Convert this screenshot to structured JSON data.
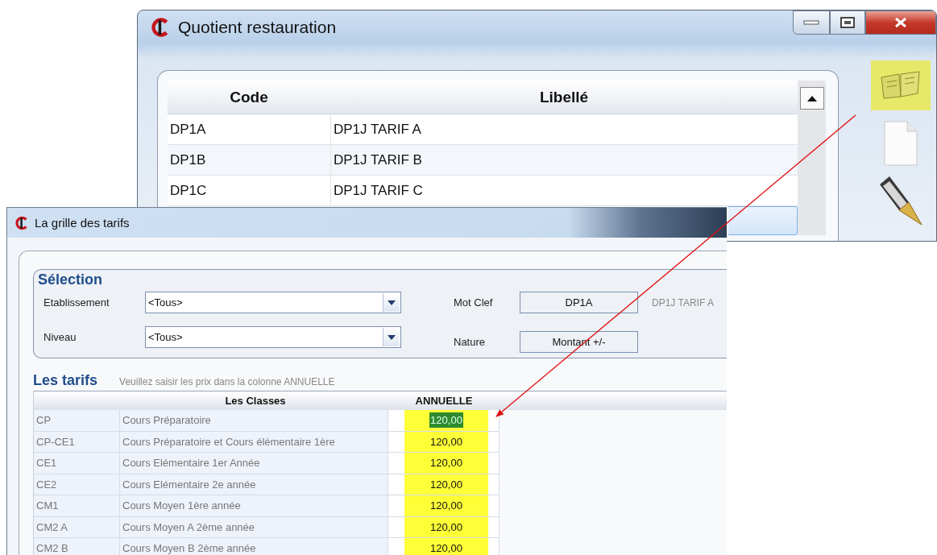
{
  "list_window": {
    "title": "Quotient restauration",
    "columns": [
      "Code",
      "Libellé"
    ],
    "rows": [
      {
        "code": "DP1A",
        "label": "DP1J TARIF A",
        "selected": false
      },
      {
        "code": "DP1B",
        "label": "DP1J TARIF B",
        "selected": false
      },
      {
        "code": "DP1C",
        "label": "DP1J TARIF C",
        "selected": false
      },
      {
        "selected": true
      }
    ],
    "toolbar": [
      {
        "kind": "book",
        "highlighted": true
      },
      {
        "kind": "page",
        "highlighted": false
      },
      {
        "kind": "pen",
        "highlighted": false
      }
    ]
  },
  "tariff_window": {
    "title": "La grille des tarifs",
    "selection": {
      "title": "Sélection",
      "dropdowns": [
        {
          "label": "Etablissement",
          "value": "<Tous>"
        },
        {
          "label": "Niveau",
          "value": "<Tous>"
        }
      ],
      "mot_clef": {
        "label": "Mot Clef",
        "value": "DP1A",
        "description": "DP1J TARIF A"
      },
      "nature": {
        "label": "Nature",
        "value": "Montant +/-"
      }
    },
    "tariffs": {
      "title": "Les tarifs",
      "hint": "Veuillez saisir les prix dans la colonne ANNUELLE",
      "columns": [
        "Les Classes",
        "ANNUELLE"
      ],
      "rows": [
        {
          "code": "CP",
          "label": "Cours Préparatoire",
          "annual": "120,00",
          "editing": true
        },
        {
          "code": "CP-CE1",
          "label": "Cours Préparatoire et Cours élémentaire 1ère",
          "annual": "120,00",
          "editing": false
        },
        {
          "code": "CE1",
          "label": "Cours Elémentaire 1er Année",
          "annual": "120,00",
          "editing": false
        },
        {
          "code": "CE2",
          "label": "Cours Elémentaire 2e année",
          "annual": "120,00",
          "editing": false
        },
        {
          "code": "CM1",
          "label": "Cours Moyen 1ère année",
          "annual": "120,00",
          "editing": false
        },
        {
          "code": "CM2 A",
          "label": "Cours Moyen A 2ème année",
          "annual": "120,00",
          "editing": false
        },
        {
          "code": "CM2 B",
          "label": "Cours Moyen B 2ème année",
          "annual": "120,00",
          "editing": false
        }
      ]
    }
  }
}
